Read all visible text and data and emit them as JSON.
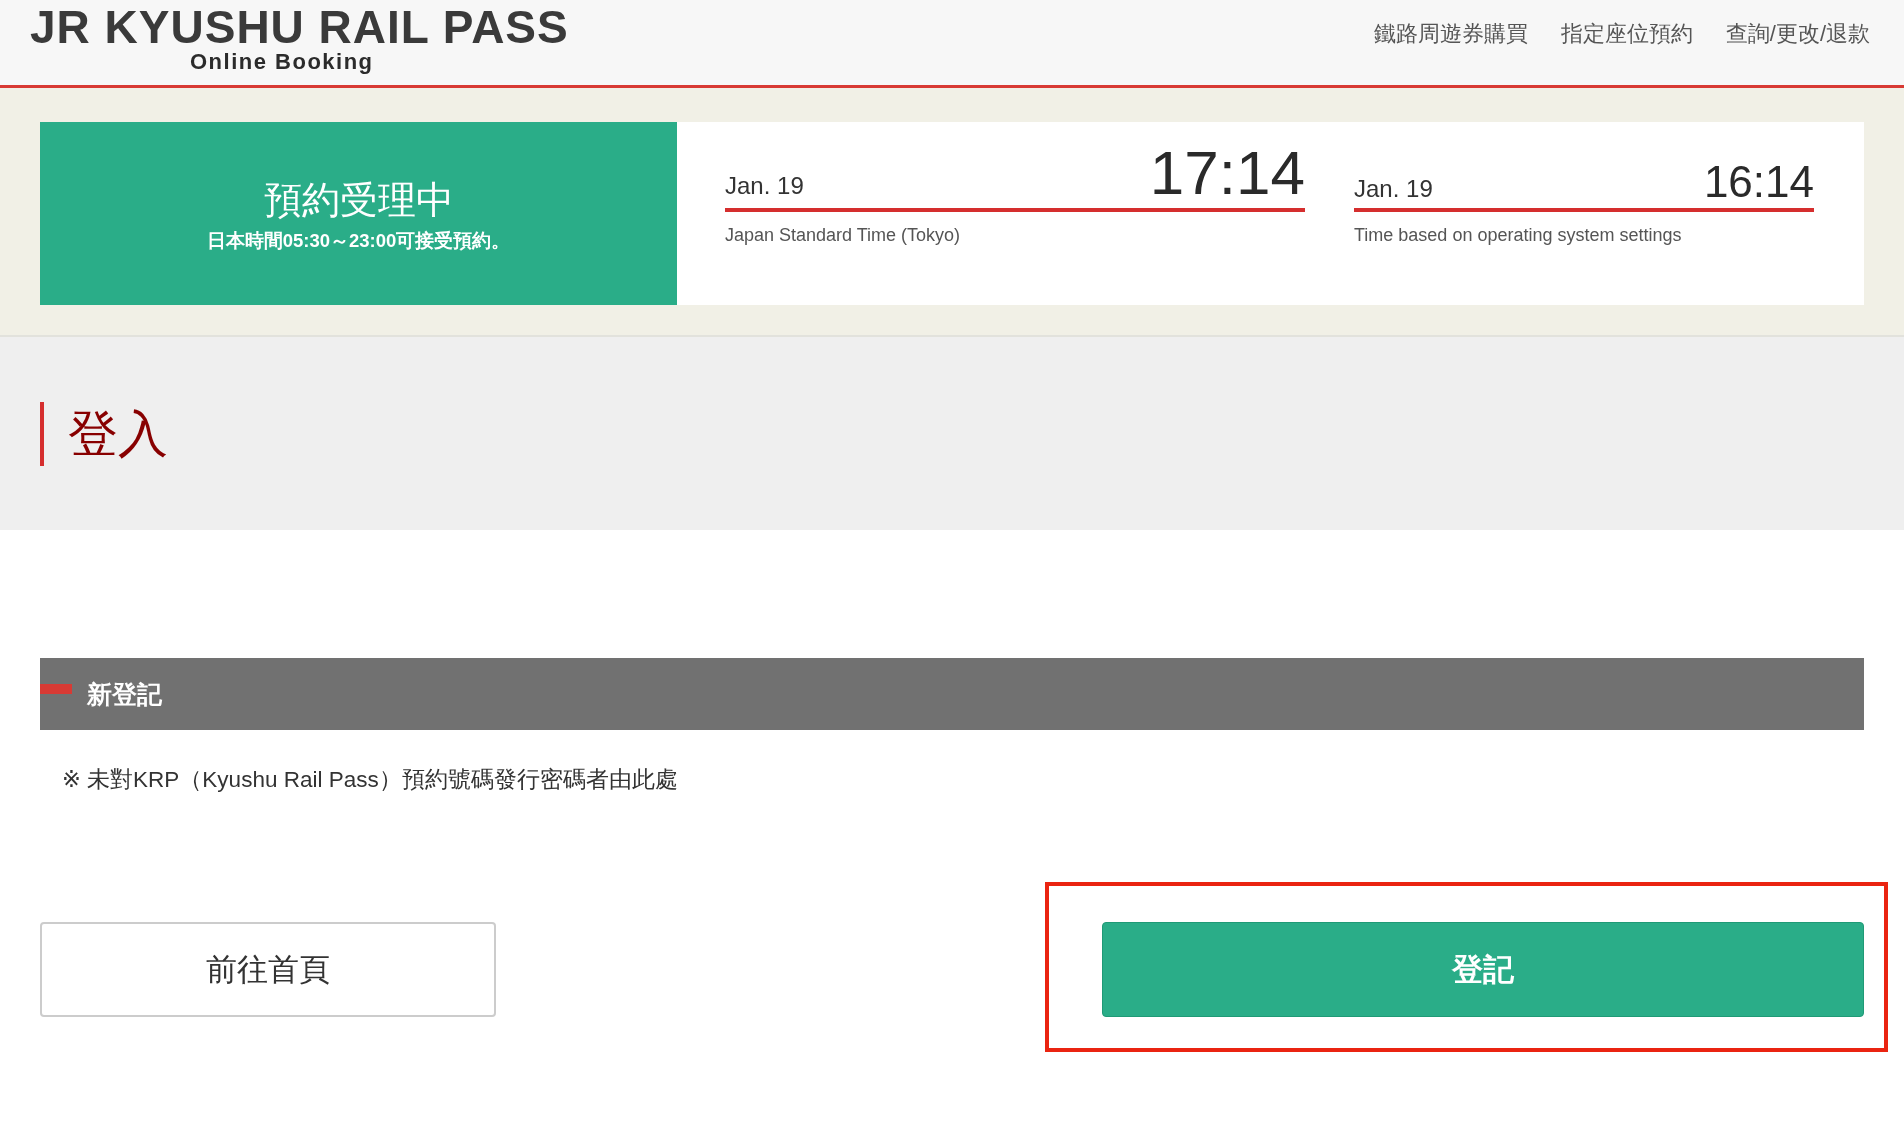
{
  "header": {
    "logo": {
      "title": "JR KYUSHU RAIL PASS",
      "subtitle": "Online Booking"
    },
    "nav": [
      "鐵路周遊券購買",
      "指定座位預約",
      "查詢/更改/退款"
    ]
  },
  "status": {
    "title": "預約受理中",
    "note": "日本時間05:30～23:00可接受預約。",
    "clocks": [
      {
        "kind": "primary",
        "date": "Jan. 19",
        "time": "17:14",
        "caption": "Japan Standard Time (Tokyo)"
      },
      {
        "kind": "secondary",
        "date": "Jan. 19",
        "time": "16:14",
        "caption": "Time based on operating system settings"
      }
    ]
  },
  "page": {
    "title": "登入"
  },
  "section": {
    "title": "新登記",
    "note": "※ 未對KRP（Kyushu Rail Pass）預約號碼發行密碼者由此處"
  },
  "buttons": [
    {
      "kind": "secondary",
      "label": "前往首頁",
      "highlighted": false
    },
    {
      "kind": "primary",
      "label": "登記",
      "highlighted": true
    }
  ]
}
